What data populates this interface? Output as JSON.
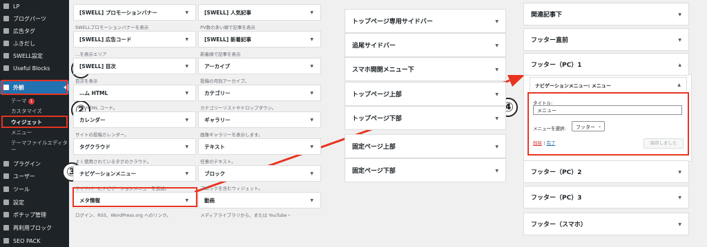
{
  "sidebar": {
    "items": [
      {
        "label": "LP",
        "icon": "page-icon"
      },
      {
        "label": "ブログパーツ",
        "icon": "blocks-icon"
      },
      {
        "label": "広告タグ",
        "icon": "ad-icon"
      },
      {
        "label": "ふきだし",
        "icon": "balloon-icon"
      },
      {
        "label": "SWELL設定",
        "icon": "settings-icon"
      },
      {
        "label": "Useful Blocks",
        "icon": "blocks-icon"
      },
      {
        "label": "外観",
        "icon": "brush-icon"
      }
    ],
    "sub_items": [
      "テーマ",
      "カスタマイズ",
      "ウィジェット",
      "メニュー",
      "テーマファイルエディター"
    ],
    "theme_badge": "1",
    "lower_items": [
      {
        "label": "プラグイン",
        "icon": "plugin-icon"
      },
      {
        "label": "ユーザー",
        "icon": "user-icon"
      },
      {
        "label": "ツール",
        "icon": "wrench-icon"
      },
      {
        "label": "設定",
        "icon": "settings-icon"
      },
      {
        "label": "ポチップ管理",
        "icon": "gear-icon"
      },
      {
        "label": "再利用ブロック",
        "icon": "reuse-icon"
      },
      {
        "label": "SEO PACK",
        "icon": "seo-icon"
      }
    ]
  },
  "widgets": [
    {
      "label": "[SWELL] プロモーションバナー",
      "desc": "SWELLプロモーションバナーを表示"
    },
    {
      "label": "[SWELL] 人気記事",
      "desc": "PV数の多い順で記事を表示"
    },
    {
      "label": "[SWELL] 広告コード",
      "desc": "…を表示エリア"
    },
    {
      "label": "[SWELL] 新着記事",
      "desc": "新着順で記事を表示"
    },
    {
      "label": "[SWELL] 目次",
      "desc": "目次を表示"
    },
    {
      "label": "アーカイブ",
      "desc": "投稿の月別アーカイブ。"
    },
    {
      "label": "…ム HTML",
      "desc": "…意 HTML コード。"
    },
    {
      "label": "カテゴリー",
      "desc": "カテゴリーリストやドロップダウン。"
    },
    {
      "label": "カレンダー",
      "desc": "サイトの投稿カレンダー。"
    },
    {
      "label": "ギャラリー",
      "desc": "画像ギャラリーを表示します。"
    },
    {
      "label": "タグクラウド",
      "desc": "よく使用されているタグのクラウド。"
    },
    {
      "label": "テキスト",
      "desc": "任意のテキスト。"
    },
    {
      "label": "ナビゲーションメニュー",
      "desc": "サイドバーにナビゲーションメニューを追加。"
    },
    {
      "label": "ブロック",
      "desc": "ブロックを含むウィジェット。"
    },
    {
      "label": "メタ情報",
      "desc": "ログイン、RSS、WordPress.org へのリンク。"
    },
    {
      "label": "動画",
      "desc": "メディアライブラリから、または YouTube・"
    }
  ],
  "areas_mid": [
    "トップページ専用サイドバー",
    "追尾サイドバー",
    "スマホ開閉メニュー下",
    "トップページ上部",
    "トップページ下部",
    "固定ページ上部",
    "固定ページ下部"
  ],
  "areas_right": [
    "関連記事下",
    "フッター直前",
    "フッター（PC）1",
    "フッター（PC）2",
    "フッター（PC）3",
    "フッター（スマホ）"
  ],
  "expanded_widget": {
    "header": "ナビゲーションメニュー: メニュー",
    "title_label": "タイトル:",
    "title_value": "メニュー",
    "menu_label": "メニューを選択:",
    "menu_value": "フッター",
    "delete_link": "削除",
    "separator": "|",
    "done_link": "完了",
    "saved_button": "保存しました"
  },
  "callouts": [
    "①",
    "②",
    "③",
    "④"
  ],
  "colors": {
    "accent": "#e8331f",
    "sidebar_bg": "#1d2327",
    "active_blue": "#2271b1"
  }
}
